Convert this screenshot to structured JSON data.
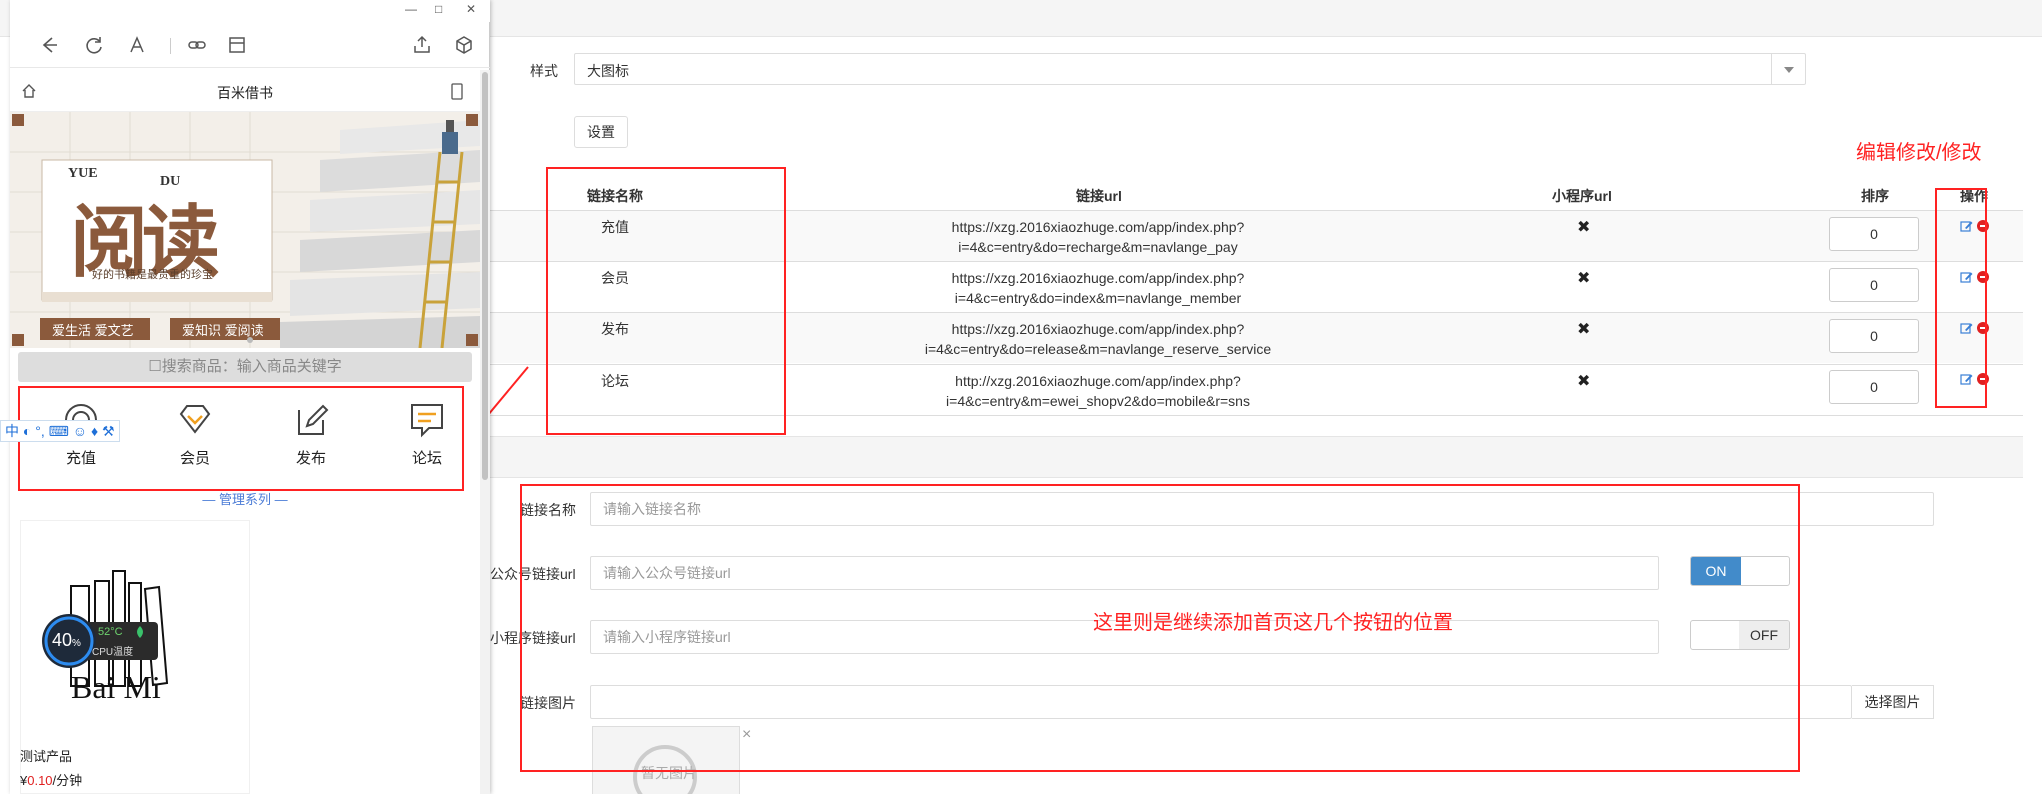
{
  "phone": {
    "window_controls": {
      "minimize": "—",
      "maximize": "□",
      "close": "✕"
    },
    "toolbar_icons": [
      "back-arrow-icon",
      "refresh-icon",
      "font-icon",
      "link-icon",
      "layout-icon",
      "share-icon",
      "cube-icon"
    ],
    "nav_title": "百米借书",
    "banner": {
      "yue": "YUE",
      "du": "DU",
      "title": "阅读",
      "slogan": "好的书籍是最贵重的珍宝",
      "tag1": "爱生活 爱文艺",
      "tag2": "爱知识 爱阅读"
    },
    "search_placeholder": "搜索商品：输入商品关键字",
    "menus": [
      {
        "label": "充值",
        "icon": "recharge-icon"
      },
      {
        "label": "会员",
        "icon": "member-icon"
      },
      {
        "label": "发布",
        "icon": "edit-icon"
      },
      {
        "label": "论坛",
        "icon": "forum-icon"
      }
    ],
    "manage_series": "— 管理系列 —",
    "product": {
      "logo_text": "Bai Mi",
      "name": "测试产品",
      "price_prefix": "¥",
      "price": "0.10",
      "price_unit": "/分钟"
    },
    "ime_text": "中",
    "cpu": {
      "percent": "40",
      "percent_unit": "%",
      "temp": "52°C",
      "label": "CPU温度"
    }
  },
  "admin": {
    "style_label": "样式",
    "style_value": "大图标",
    "set_button": "设置",
    "table": {
      "headers": [
        "链接名称",
        "链接url",
        "小程序url",
        "排序",
        "操作"
      ],
      "rows": [
        {
          "name": "充值",
          "url1": "https://xzg.2016xiaozhuge.com/app/index.php?",
          "url2": "i=4&c=entry&do=recharge&m=navlange_pay",
          "mini": "✖",
          "sort": "0"
        },
        {
          "name": "会员",
          "url1": "https://xzg.2016xiaozhuge.com/app/index.php?",
          "url2": "i=4&c=entry&do=index&m=navlange_member",
          "mini": "✖",
          "sort": "0"
        },
        {
          "name": "发布",
          "url1": "https://xzg.2016xiaozhuge.com/app/index.php?",
          "url2": "i=4&c=entry&do=release&m=navlange_reserve_service",
          "mini": "✖",
          "sort": "0"
        },
        {
          "name": "论坛",
          "url1": "http://xzg.2016xiaozhuge.com/app/index.php?",
          "url2": "i=4&c=entry&m=ewei_shopv2&do=mobile&r=sns",
          "mini": "✖",
          "sort": "0"
        }
      ]
    },
    "form": {
      "name_label": "链接名称",
      "name_placeholder": "请输入链接名称",
      "mp_label": "公众号链接url",
      "mp_placeholder": "请输入公众号链接url",
      "mini_label": "小程序链接url",
      "mini_placeholder": "请输入小程序链接url",
      "img_label": "链接图片",
      "pick_image": "选择图片",
      "no_image": "暂无图片",
      "switch_on": "ON",
      "switch_off": "OFF",
      "remove": "×"
    }
  },
  "annotations": {
    "edit_note": "编辑修改/修改",
    "add_note": "这里则是继续添加首页这几个按钮的位置"
  },
  "colors": {
    "accent_red": "#ff2222",
    "switch_blue": "#428bca",
    "banner_brown": "#8b5a3c"
  }
}
